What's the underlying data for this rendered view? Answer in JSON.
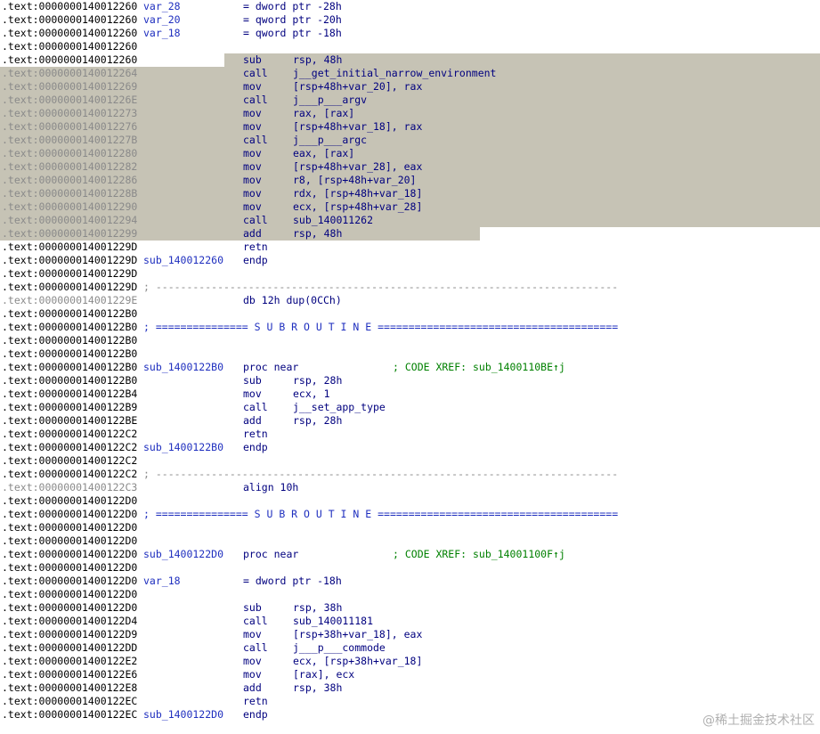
{
  "colors": {
    "highlight": "#c6c3b5",
    "address": "#000000",
    "address_dim": "#8a8a8a",
    "label": "#1f2fbf",
    "mnemonic": "#00007f",
    "comment": "#008000",
    "separator": "#8a8a8a"
  },
  "watermark": "@稀土掘金技术社区",
  "lines": [
    {
      "addr": ".text:0000000140012260",
      "label": "var_28",
      "mnem": "= dword ptr -28h"
    },
    {
      "addr": ".text:0000000140012260",
      "label": "var_20",
      "mnem": "= qword ptr -20h"
    },
    {
      "addr": ".text:0000000140012260",
      "label": "var_18",
      "mnem": "= qword ptr -18h"
    },
    {
      "addr": ".text:0000000140012260"
    },
    {
      "addr": ".text:0000000140012260",
      "mnem": "sub",
      "ops": "rsp, 48h"
    },
    {
      "addr": ".text:0000000140012264",
      "mnem": "call",
      "ops": "j__get_initial_narrow_environment",
      "dim": true
    },
    {
      "addr": ".text:0000000140012269",
      "mnem": "mov",
      "ops": "[rsp+48h+var_20], rax",
      "dim": true
    },
    {
      "addr": ".text:000000014001226E",
      "mnem": "call",
      "ops": "j___p___argv",
      "dim": true
    },
    {
      "addr": ".text:0000000140012273",
      "mnem": "mov",
      "ops": "rax, [rax]",
      "dim": true
    },
    {
      "addr": ".text:0000000140012276",
      "mnem": "mov",
      "ops": "[rsp+48h+var_18], rax",
      "dim": true
    },
    {
      "addr": ".text:000000014001227B",
      "mnem": "call",
      "ops": "j___p___argc",
      "dim": true
    },
    {
      "addr": ".text:0000000140012280",
      "mnem": "mov",
      "ops": "eax, [rax]",
      "dim": true
    },
    {
      "addr": ".text:0000000140012282",
      "mnem": "mov",
      "ops": "[rsp+48h+var_28], eax",
      "dim": true
    },
    {
      "addr": ".text:0000000140012286",
      "mnem": "mov",
      "ops": "r8, [rsp+48h+var_20]",
      "dim": true
    },
    {
      "addr": ".text:000000014001228B",
      "mnem": "mov",
      "ops": "rdx, [rsp+48h+var_18]",
      "dim": true
    },
    {
      "addr": ".text:0000000140012290",
      "mnem": "mov",
      "ops": "ecx, [rsp+48h+var_28]",
      "dim": true
    },
    {
      "addr": ".text:0000000140012294",
      "mnem": "call",
      "ops": "sub_140011262",
      "dim": true
    },
    {
      "addr": ".text:0000000140012299",
      "mnem": "add",
      "ops": "rsp, 48h",
      "dim": true
    },
    {
      "addr": ".text:000000014001229D",
      "mnem": "retn"
    },
    {
      "addr": ".text:000000014001229D",
      "label": "sub_140012260",
      "mnem": "endp"
    },
    {
      "addr": ".text:000000014001229D"
    },
    {
      "addr": ".text:000000014001229D",
      "sep": "; ---------------------------------------------------------------------------"
    },
    {
      "addr": ".text:000000014001229E",
      "mnem": "db 12h dup(0CCh)",
      "dim": true
    },
    {
      "addr": ".text:00000001400122B0"
    },
    {
      "addr": ".text:00000001400122B0",
      "sepb": "; =============== S U B R O U T I N E ======================================="
    },
    {
      "addr": ".text:00000001400122B0"
    },
    {
      "addr": ".text:00000001400122B0"
    },
    {
      "addr": ".text:00000001400122B0",
      "label": "sub_1400122B0",
      "mnem": "proc near",
      "cmt": "; CODE XREF: sub_1400110BE↑j"
    },
    {
      "addr": ".text:00000001400122B0",
      "mnem": "sub",
      "ops": "rsp, 28h"
    },
    {
      "addr": ".text:00000001400122B4",
      "mnem": "mov",
      "ops": "ecx, 1"
    },
    {
      "addr": ".text:00000001400122B9",
      "mnem": "call",
      "ops": "j__set_app_type"
    },
    {
      "addr": ".text:00000001400122BE",
      "mnem": "add",
      "ops": "rsp, 28h"
    },
    {
      "addr": ".text:00000001400122C2",
      "mnem": "retn"
    },
    {
      "addr": ".text:00000001400122C2",
      "label": "sub_1400122B0",
      "mnem": "endp"
    },
    {
      "addr": ".text:00000001400122C2"
    },
    {
      "addr": ".text:00000001400122C2",
      "sep": "; ---------------------------------------------------------------------------"
    },
    {
      "addr": ".text:00000001400122C3",
      "mnem": "align 10h",
      "dim": true
    },
    {
      "addr": ".text:00000001400122D0"
    },
    {
      "addr": ".text:00000001400122D0",
      "sepb": "; =============== S U B R O U T I N E ======================================="
    },
    {
      "addr": ".text:00000001400122D0"
    },
    {
      "addr": ".text:00000001400122D0"
    },
    {
      "addr": ".text:00000001400122D0",
      "label": "sub_1400122D0",
      "mnem": "proc near",
      "cmt": "; CODE XREF: sub_14001100F↑j"
    },
    {
      "addr": ".text:00000001400122D0"
    },
    {
      "addr": ".text:00000001400122D0",
      "label": "var_18",
      "mnem": "= dword ptr -18h"
    },
    {
      "addr": ".text:00000001400122D0"
    },
    {
      "addr": ".text:00000001400122D0",
      "mnem": "sub",
      "ops": "rsp, 38h"
    },
    {
      "addr": ".text:00000001400122D4",
      "mnem": "call",
      "ops": "sub_140011181"
    },
    {
      "addr": ".text:00000001400122D9",
      "mnem": "mov",
      "ops": "[rsp+38h+var_18], eax"
    },
    {
      "addr": ".text:00000001400122DD",
      "mnem": "call",
      "ops": "j___p___commode"
    },
    {
      "addr": ".text:00000001400122E2",
      "mnem": "mov",
      "ops": "ecx, [rsp+38h+var_18]"
    },
    {
      "addr": ".text:00000001400122E6",
      "mnem": "mov",
      "ops": "[rax], ecx"
    },
    {
      "addr": ".text:00000001400122E8",
      "mnem": "add",
      "ops": "rsp, 38h"
    },
    {
      "addr": ".text:00000001400122EC",
      "mnem": "retn"
    },
    {
      "addr": ".text:00000001400122EC",
      "label": "sub_1400122D0",
      "mnem": "endp"
    }
  ]
}
